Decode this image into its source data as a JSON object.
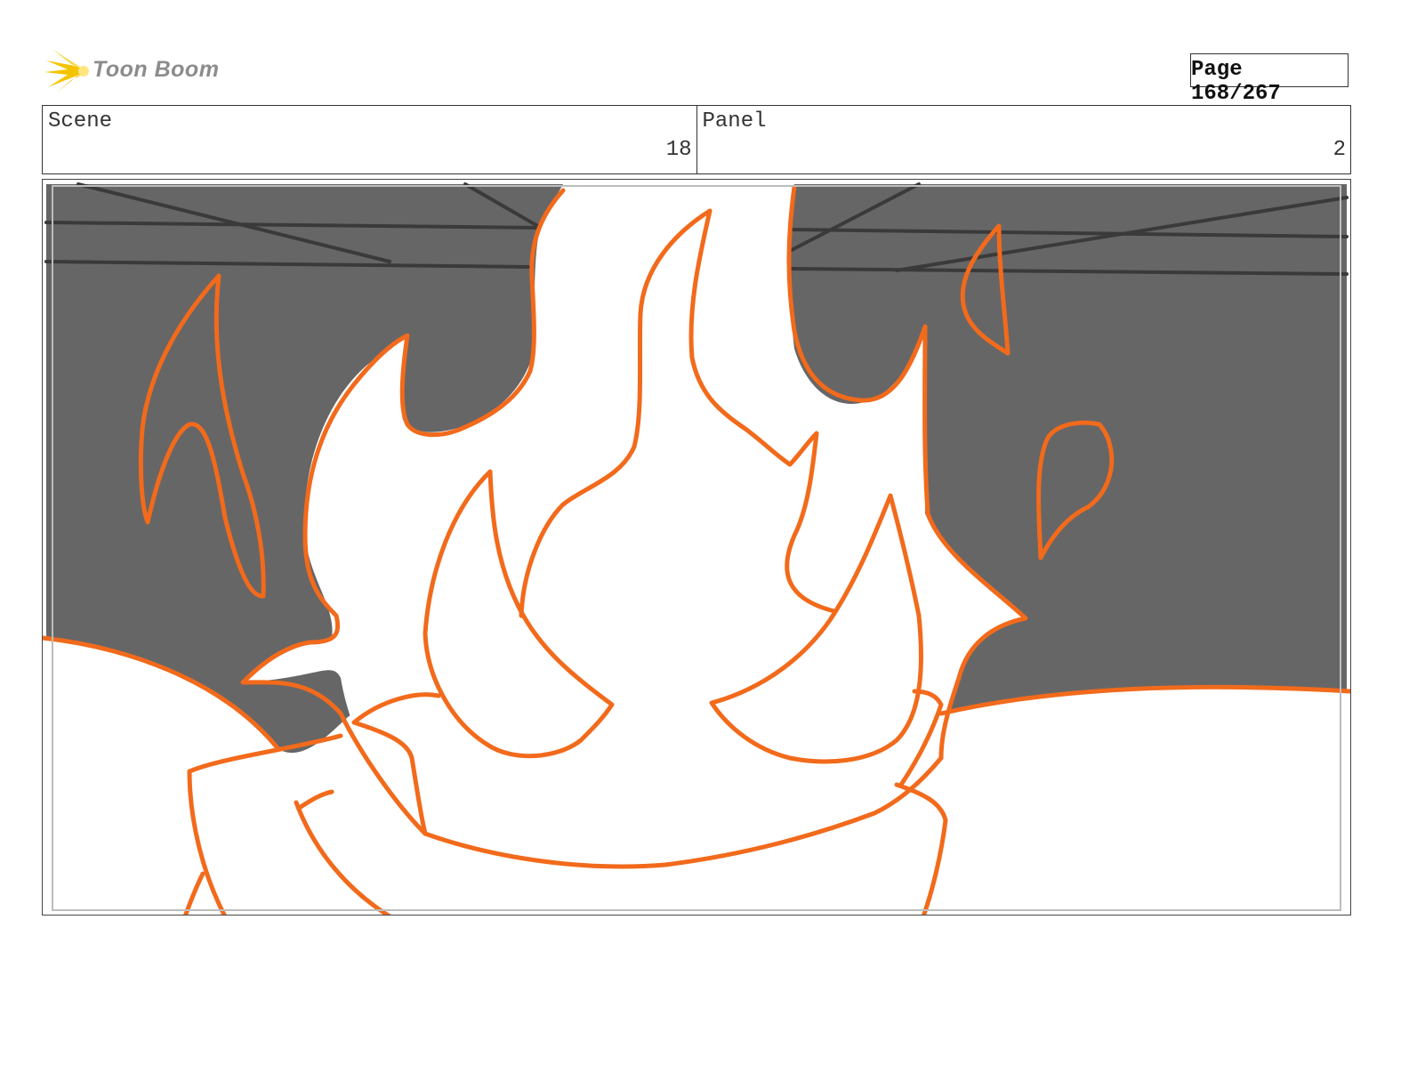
{
  "header": {
    "logo_text": "Toon Boom",
    "page_label": "Page 168/267"
  },
  "scene": {
    "label": "Scene",
    "value": "18"
  },
  "panel": {
    "label": "Panel",
    "value": "2"
  },
  "colors": {
    "flame_stroke": "#f26a1b",
    "background_gray": "#666666",
    "ceiling_lines": "#3a3a3a",
    "logo_flash": "#f5c400",
    "logo_text": "#8c8c8c"
  }
}
